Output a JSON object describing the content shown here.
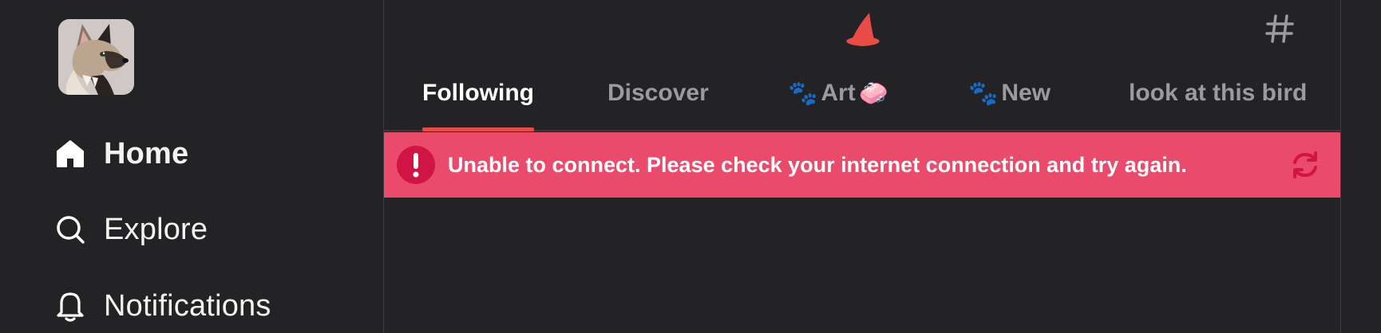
{
  "sidebar": {
    "avatar_icon": "dog-avatar-icon",
    "items": [
      {
        "label": "Home",
        "icon": "house-icon",
        "active": true
      },
      {
        "label": "Explore",
        "icon": "search-icon",
        "active": false
      },
      {
        "label": "Notifications",
        "icon": "bell-icon",
        "active": false
      }
    ]
  },
  "header": {
    "logo_icon": "witch-hat-icon",
    "feeds_icon": "hash-icon"
  },
  "tabs": [
    {
      "label": "Following",
      "active": true
    },
    {
      "label": "Discover",
      "active": false
    },
    {
      "prefix_emoji": "🐾",
      "label": "Art",
      "suffix_emoji": "🧼",
      "active": false
    },
    {
      "prefix_emoji": "🐾",
      "label": "New",
      "active": false
    },
    {
      "label": "look at this bird",
      "active": false
    }
  ],
  "error": {
    "message": "Unable to connect. Please check your internet connection and try again.",
    "icon": "exclamation-icon",
    "retry_icon": "refresh-icon"
  },
  "colors": {
    "background": "#232224",
    "accent": "#e84c44",
    "error_banner": "#ea4b6a",
    "error_icon": "#d01445"
  }
}
